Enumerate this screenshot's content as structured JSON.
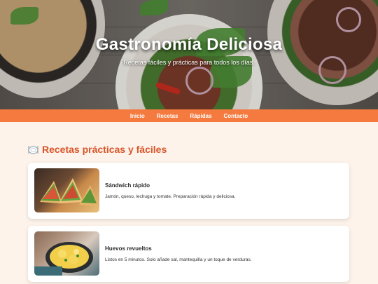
{
  "hero": {
    "title": "Gastronomía Deliciosa",
    "subtitle": "Recetas fáciles y prácticas para todos los días."
  },
  "nav": {
    "items": [
      {
        "label": "Inicio"
      },
      {
        "label": "Recetas"
      },
      {
        "label": "Rápidas"
      },
      {
        "label": "Contacto"
      }
    ]
  },
  "section": {
    "title": "Recetas prácticas y fáciles",
    "icon": "plate-icon"
  },
  "recipes": [
    {
      "title": "Sándwich rápido",
      "description": "Jamón, queso, lechuga y tomate. Preparación rápida y deliciosa.",
      "image": "sandwich-photo"
    },
    {
      "title": "Huevos revueltos",
      "description": "Listos en 5 minutos. Solo añade sal, mantequilla y un toque de verduras.",
      "image": "scrambled-eggs-photo"
    }
  ],
  "colors": {
    "accent": "#f47a40",
    "section_title": "#d9542a",
    "page_background": "#fdf3ea"
  }
}
